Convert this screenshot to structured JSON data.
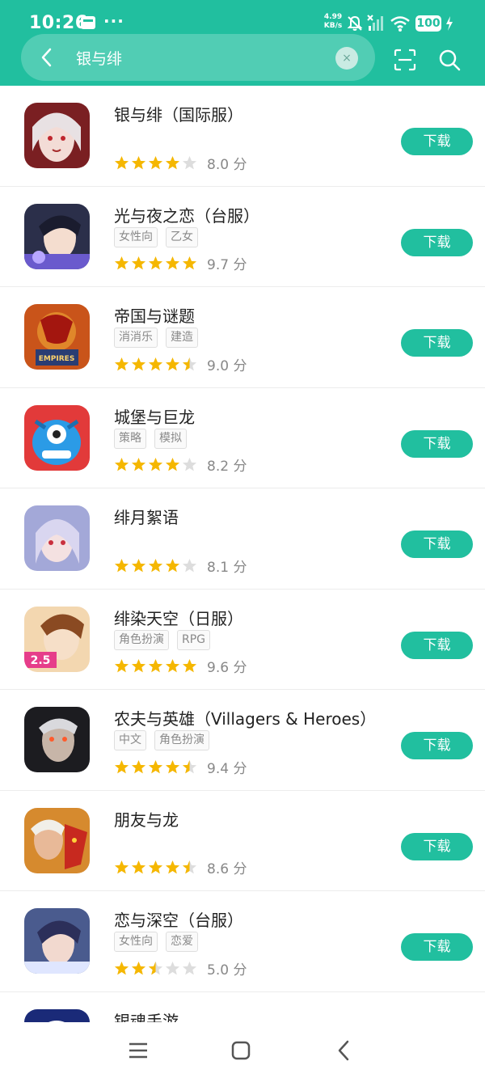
{
  "status_bar": {
    "time": "10:26",
    "dots": "···",
    "net_speed_value": "4.99",
    "net_speed_unit": "KB/s",
    "battery": "100"
  },
  "search": {
    "query": "银与绯",
    "icons": [
      "back-arrow-icon",
      "clear-icon",
      "scan-icon",
      "search-icon"
    ],
    "clear_glyph": "×"
  },
  "colors": {
    "brand": "#21bf9f",
    "star": "#f5b700",
    "star_empty": "#dddddd"
  },
  "results": [
    {
      "name": "银与绯（国际服）",
      "tags": [],
      "rating": 4,
      "score": "8.0 分",
      "action": "下载"
    },
    {
      "name": "光与夜之恋（台服）",
      "tags": [
        "女性向",
        "乙女"
      ],
      "rating": 5,
      "score": "9.7 分",
      "action": "下载"
    },
    {
      "name": "帝国与谜题",
      "tags": [
        "消消乐",
        "建造"
      ],
      "rating": 4.5,
      "score": "9.0 分",
      "action": "下载"
    },
    {
      "name": "城堡与巨龙",
      "tags": [
        "策略",
        "模拟"
      ],
      "rating": 4,
      "score": "8.2 分",
      "action": "下载"
    },
    {
      "name": "绯月絮语",
      "tags": [],
      "rating": 4,
      "score": "8.1 分",
      "action": "下载"
    },
    {
      "name": "绯染天空（日服）",
      "tags": [
        "角色扮演",
        "RPG"
      ],
      "rating": 5,
      "score": "9.6 分",
      "action": "下载"
    },
    {
      "name": "农夫与英雄（Villagers & Heroes）",
      "tags": [
        "中文",
        "角色扮演"
      ],
      "rating": 4.5,
      "score": "9.4 分",
      "action": "下载"
    },
    {
      "name": "朋友与龙",
      "tags": [],
      "rating": 4.5,
      "score": "8.6 分",
      "action": "下载"
    },
    {
      "name": "恋与深空（台服）",
      "tags": [
        "女性向",
        "恋爱"
      ],
      "rating": 2.5,
      "score": "5.0 分",
      "action": "下载"
    }
  ],
  "partial_result": {
    "name": "银魂手游"
  },
  "nav": {
    "icons": [
      "menu-icon",
      "home-icon",
      "back-icon"
    ]
  }
}
